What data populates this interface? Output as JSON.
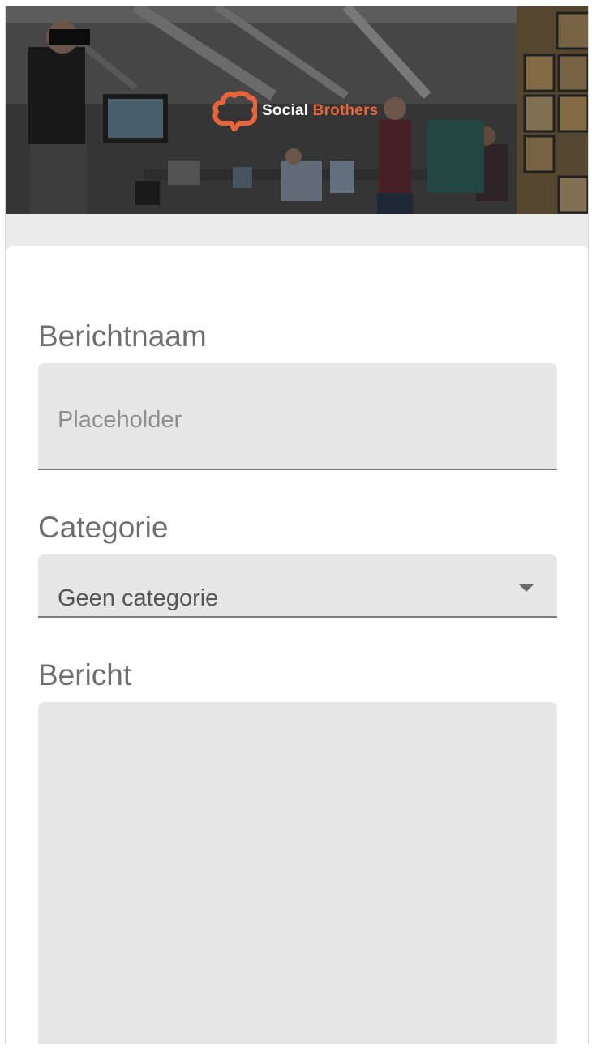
{
  "header": {
    "brand_word1": "Social",
    "brand_word2": "Brothers",
    "brand_color": "#e8643c",
    "logo_icon": "cloud-brand-icon"
  },
  "form": {
    "title_field": {
      "label": "Berichtnaam",
      "placeholder": "Placeholder"
    },
    "category_field": {
      "label": "Categorie",
      "selected": "Geen categorie",
      "icon": "dropdown-caret-icon"
    },
    "message_field": {
      "label": "Bericht",
      "value": ""
    }
  }
}
